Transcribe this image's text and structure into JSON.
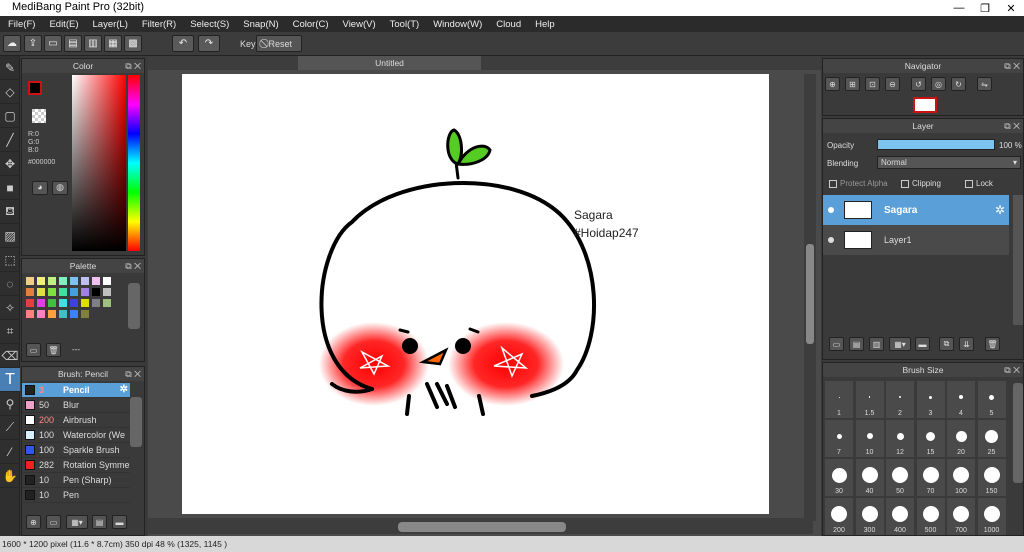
{
  "window": {
    "title": "MediBang Paint Pro (32bit)",
    "minimize": "—",
    "maximize": "❐",
    "close": "✕"
  },
  "menu": [
    "File(F)",
    "Edit(E)",
    "Layer(L)",
    "Filter(R)",
    "Select(S)",
    "Snap(N)",
    "Color(C)",
    "View(V)",
    "Tool(T)",
    "Window(W)",
    "Cloud",
    "Help"
  ],
  "toolbar": {
    "key_label": "Key",
    "reset_label": "Reset"
  },
  "color_panel": {
    "title": "Color",
    "r": "R:0",
    "g": "G:0",
    "b": "B:0",
    "hex": "#000000",
    "fg": "#000000",
    "accent": "#cc1111"
  },
  "palette_panel": {
    "title": "Palette",
    "separator": "---"
  },
  "brush_panel": {
    "title": "Brush: Pencil",
    "items": [
      {
        "size": "3",
        "name": "Pencil",
        "color": "#222222"
      },
      {
        "size": "50",
        "name": "Blur",
        "color": "#f0a0c8"
      },
      {
        "size": "200",
        "name": "Airbrush",
        "color": "#ffffff"
      },
      {
        "size": "100",
        "name": "Watercolor (We",
        "color": "#d8f0ff"
      },
      {
        "size": "100",
        "name": "Sparkle Brush",
        "color": "#3355ee"
      },
      {
        "size": "282",
        "name": "Rotation Symme",
        "color": "#ee2222"
      },
      {
        "size": "10",
        "name": "Pen (Sharp)",
        "color": "#222222"
      },
      {
        "size": "10",
        "name": "Pen",
        "color": "#222222"
      }
    ]
  },
  "document": {
    "tab_title": "Untitled",
    "artwork_text1": "Sagara",
    "artwork_text2": "#Hoidap247"
  },
  "navigator": {
    "title": "Navigator"
  },
  "layer_panel": {
    "title": "Layer",
    "opacity_label": "Opacity",
    "opacity_value": "100 %",
    "opacity_fraction": 1.0,
    "blending_label": "Blending",
    "blending_value": "Normal",
    "protect_alpha": "Protect Alpha",
    "clipping": "Clipping",
    "lock": "Lock",
    "layers": [
      {
        "name": "Sagara",
        "selected": true
      },
      {
        "name": "Layer1",
        "selected": false
      }
    ]
  },
  "brush_size_panel": {
    "title": "Brush Size",
    "sizes": [
      "1",
      "1.5",
      "2",
      "3",
      "4",
      "5",
      "7",
      "10",
      "12",
      "15",
      "20",
      "25",
      "30",
      "40",
      "50",
      "70",
      "100",
      "150",
      "200",
      "300",
      "400",
      "500",
      "700",
      "1000"
    ]
  },
  "status": {
    "text": "1600 * 1200 pixel   (11.6 * 8.7cm)   350 dpi   48 %   (1325, 1145 )"
  }
}
